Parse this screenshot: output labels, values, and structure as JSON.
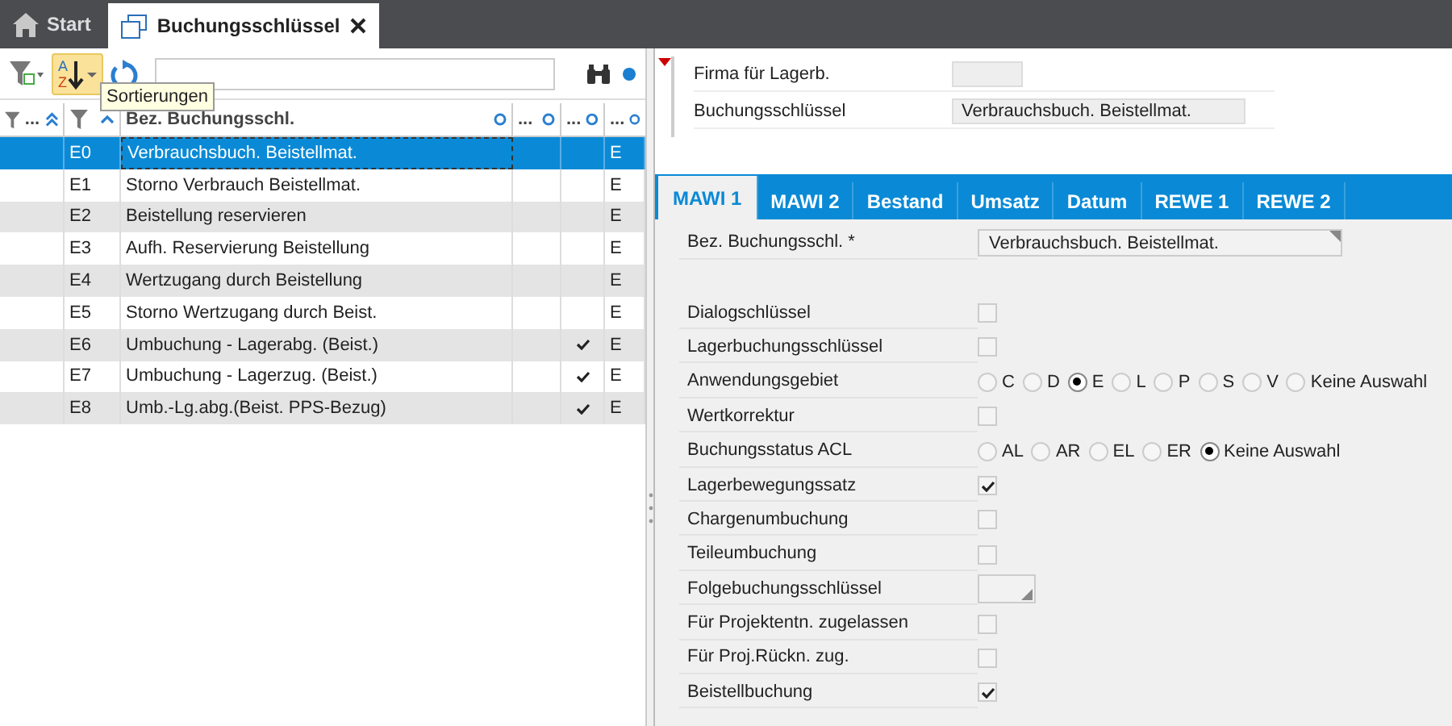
{
  "app_tabs": [
    {
      "label": "Start",
      "kind": "home",
      "selected": false
    },
    {
      "label": "Buchungsschlüssel",
      "kind": "window",
      "selected": true
    }
  ],
  "toolbar": {
    "sort_letters": [
      "A",
      "Z"
    ],
    "tooltip": "Sortierungen"
  },
  "table": {
    "columns": [
      {
        "kind": "filter",
        "label": "..."
      },
      {
        "kind": "sort"
      },
      {
        "kind": "text",
        "label": "Bez. Buchungsschl."
      },
      {
        "kind": "text",
        "label": "..."
      },
      {
        "kind": "text",
        "label": "..."
      },
      {
        "kind": "text",
        "label": "..."
      }
    ],
    "rows": [
      {
        "code": "E0",
        "name": "Verbrauchsbuch. Beistellmat.",
        "checked": false,
        "column_6": "E",
        "selected": true
      },
      {
        "code": "E1",
        "name": "Storno Verbrauch Beistellmat.",
        "checked": false,
        "column_6": "E",
        "selected": false
      },
      {
        "code": "E2",
        "name": "Beistellung reservieren",
        "checked": false,
        "column_6": "E",
        "selected": false
      },
      {
        "code": "E3",
        "name": "Aufh. Reservierung Beistellung",
        "checked": false,
        "column_6": "E",
        "selected": false
      },
      {
        "code": "E4",
        "name": "Wertzugang durch Beistellung",
        "checked": false,
        "column_6": "E",
        "selected": false
      },
      {
        "code": "E5",
        "name": "Storno Wertzugang durch Beist.",
        "checked": false,
        "column_6": "E",
        "selected": false
      },
      {
        "code": "E6",
        "name": "Umbuchung - Lagerabg. (Beist.)",
        "checked": true,
        "column_6": "E",
        "selected": false
      },
      {
        "code": "E7",
        "name": "Umbuchung - Lagerzug. (Beist.)",
        "checked": true,
        "column_6": "E",
        "selected": false
      },
      {
        "code": "E8",
        "name": "Umb.-Lg.abg.(Beist. PPS-Bezug)",
        "checked": true,
        "column_6": "E",
        "selected": false
      }
    ]
  },
  "header_fields": [
    {
      "label": "Firma für Lagerb."
    },
    {
      "label": "Buchungsschlüssel",
      "value": "Verbrauchsbuch. Beistellmat."
    }
  ],
  "detail_tabs": [
    {
      "label": "MAWI 1",
      "selected": true
    },
    {
      "label": "MAWI 2",
      "selected": false
    },
    {
      "label": "Bestand",
      "selected": false
    },
    {
      "label": "Umsatz",
      "selected": false
    },
    {
      "label": "Datum",
      "selected": false
    },
    {
      "label": "REWE 1",
      "selected": false
    },
    {
      "label": "REWE 2",
      "selected": false
    }
  ],
  "form": [
    {
      "kind": "text",
      "label": "Bez. Buchungsschl. *",
      "value": "Verbrauchsbuch. Beistellmat."
    },
    {
      "kind": "checkbox",
      "label": "Dialogschlüssel",
      "checked": false
    },
    {
      "kind": "checkbox",
      "label": "Lagerbuchungsschlüssel",
      "checked": false
    },
    {
      "kind": "radio",
      "label": "Anwendungsgebiet",
      "options": [
        {
          "label": "C",
          "selected": false
        },
        {
          "label": "D",
          "selected": false
        },
        {
          "label": "E",
          "selected": true
        },
        {
          "label": "L",
          "selected": false
        },
        {
          "label": "P",
          "selected": false
        },
        {
          "label": "S",
          "selected": false
        },
        {
          "label": "V",
          "selected": false
        },
        {
          "label": "Keine Auswahl",
          "selected": false
        }
      ]
    },
    {
      "kind": "checkbox",
      "label": "Wertkorrektur",
      "checked": false
    },
    {
      "kind": "radio",
      "label": "Buchungsstatus ACL",
      "options": [
        {
          "label": "AL",
          "selected": false
        },
        {
          "label": "AR",
          "selected": false
        },
        {
          "label": "EL",
          "selected": false
        },
        {
          "label": "ER",
          "selected": false
        },
        {
          "label": "Keine Auswahl",
          "selected": true
        }
      ]
    },
    {
      "kind": "checkbox",
      "label": "Lagerbewegungssatz",
      "checked": true
    },
    {
      "kind": "checkbox",
      "label": "Chargenumbuchung",
      "checked": false
    },
    {
      "kind": "checkbox",
      "label": "Teileumbuchung",
      "checked": false
    },
    {
      "kind": "lookup",
      "label": "Folgebuchungsschlüssel"
    },
    {
      "kind": "checkbox",
      "label": "Für Projektentn. zugelassen",
      "checked": false
    },
    {
      "kind": "checkbox",
      "label": "Für Proj.Rückn. zug.",
      "checked": false
    },
    {
      "kind": "checkbox",
      "label": "Beistellbuchung",
      "checked": true
    }
  ]
}
